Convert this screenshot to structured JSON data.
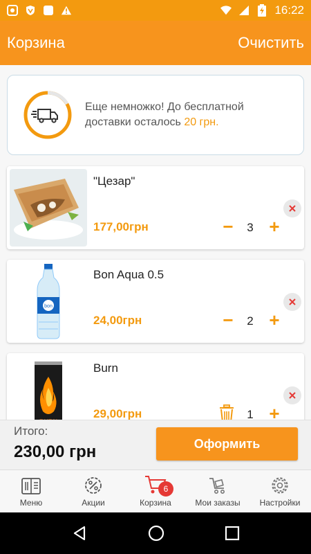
{
  "status_bar": {
    "time": "16:22"
  },
  "app_bar": {
    "title": "Корзина",
    "action": "Очистить"
  },
  "notice": {
    "line1": "Еще немножко! До бесплатной",
    "line2_prefix": "доставки осталось ",
    "amount": "20 грн."
  },
  "cart_items": [
    {
      "name": "\"Цезар\"",
      "price": "177,00грн",
      "quantity": "3",
      "image": "shawarma-wrap"
    },
    {
      "name": "Bon Aqua 0.5",
      "price": "24,00грн",
      "quantity": "2",
      "image": "water-bottle"
    },
    {
      "name": "Burn",
      "price": "29,00грн",
      "quantity": "1",
      "image": "energy-drink-can"
    }
  ],
  "totals": {
    "label": "Итого:",
    "value": "230,00 грн",
    "checkout_label": "Оформить"
  },
  "bottom_nav": [
    {
      "label": "Меню",
      "icon": "menu-book-icon"
    },
    {
      "label": "Акции",
      "icon": "discount-icon"
    },
    {
      "label": "Корзина",
      "icon": "cart-icon",
      "badge": "6",
      "active": true
    },
    {
      "label": "Мои заказы",
      "icon": "orders-cart-icon"
    },
    {
      "label": "Настройки",
      "icon": "settings-gear-icon"
    }
  ],
  "colors": {
    "accent": "#f7941d",
    "price": "#f39a0f",
    "badge": "#e53935"
  }
}
